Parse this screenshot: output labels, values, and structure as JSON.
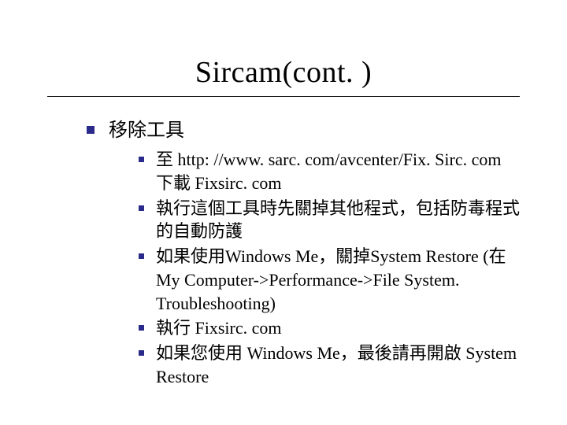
{
  "slide": {
    "title": "Sircam(cont. )",
    "section_heading": "移除工具",
    "items": [
      "至 http: //www. sarc. com/avcenter/Fix. Sirc. com 下載 Fixsirc. com",
      "執行這個工具時先關掉其他程式，包括防毒程式的自動防護",
      "如果使用Windows Me，關掉System Restore (在My Computer->Performance->File System. Troubleshooting)",
      "執行 Fixsirc. com",
      "如果您使用 Windows Me，最後請再開啟 System Restore"
    ]
  }
}
